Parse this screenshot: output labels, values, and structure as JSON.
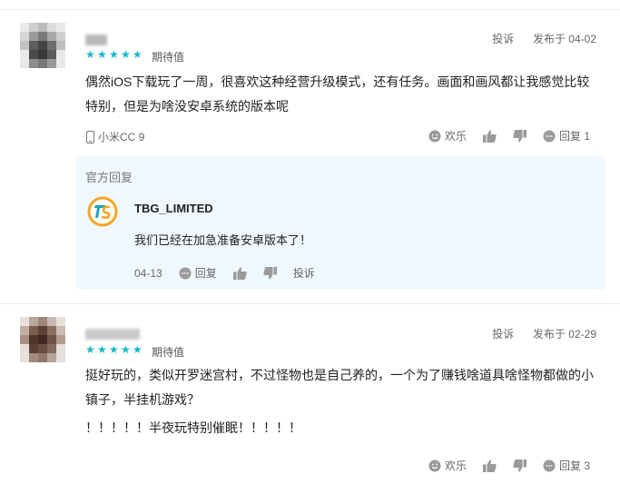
{
  "reviews": [
    {
      "rating": 5,
      "rating_label": "期待值",
      "report": "投诉",
      "published": "发布于 04-02",
      "text": "偶然iOS下载玩了一周，很喜欢这种经营升级模式，还有任务。画面和画风都让我感觉比较特别，但是为啥没安卓系统的版本呢",
      "device": "小米CC 9",
      "actions": {
        "fun": "欢乐",
        "reply": "回复 1"
      },
      "official_reply": {
        "label": "官方回复",
        "author": "TBG_LIMITED",
        "text": "我们已经在加急准备安卓版本了！",
        "date": "04-13",
        "reply": "回复",
        "report": "投诉"
      }
    },
    {
      "rating": 5,
      "rating_label": "期待值",
      "report": "投诉",
      "published": "发布于 02-29",
      "text": "挺好玩的，类似开罗迷宫村，不过怪物也是自己养的，一个为了赚钱啥道具啥怪物都做的小镇子，半挂机游戏？",
      "text2": "！！！！！半夜玩特别催眠！！！！！",
      "actions": {
        "fun": "欢乐",
        "reply": "回复 3"
      }
    }
  ],
  "colors": {
    "star": "#14b9c8",
    "reply_bg": "#f0f8fd",
    "logo_orange": "#f5a623",
    "logo_teal": "#1aa1b8"
  }
}
